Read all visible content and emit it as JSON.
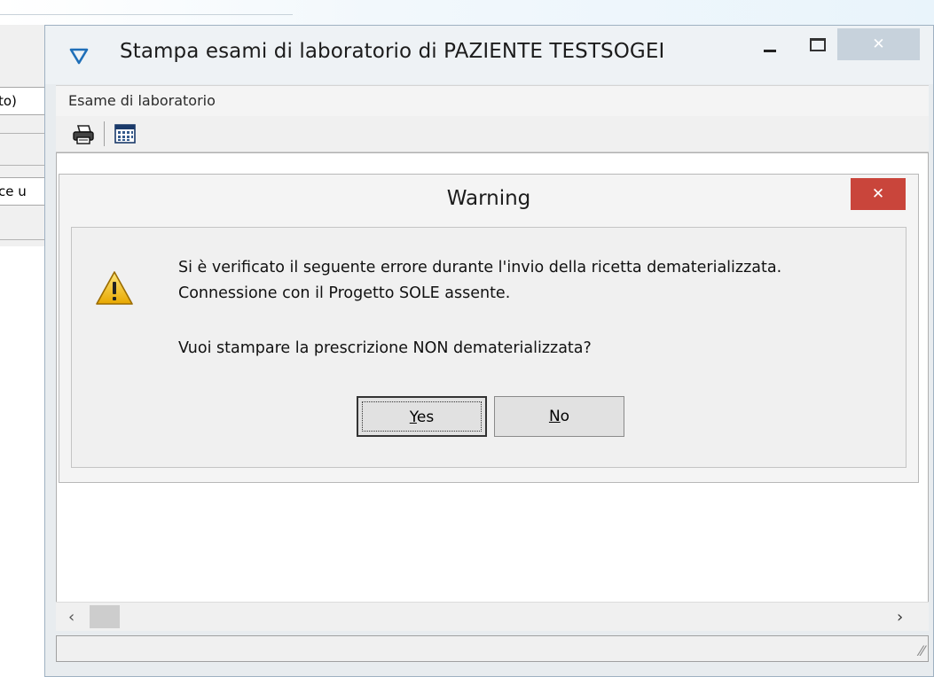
{
  "background_window": {
    "field1_text": "to)",
    "field2_text": "ce u"
  },
  "window": {
    "title": "Stampa esami di laboratorio di PAZIENTE TESTSOGEI",
    "app_icon": "triangle-down-icon",
    "close_symbol": "✕",
    "menu": [
      "Esame di laboratorio"
    ],
    "toolbar": [
      {
        "name": "print-icon"
      },
      {
        "name": "calendar-icon"
      }
    ],
    "scroll_left": "‹",
    "scroll_right": "›"
  },
  "dialog": {
    "title": "Warning",
    "close_symbol": "✕",
    "icon": "warning-icon",
    "message_line1": "Si è verificato il seguente errore durante l'invio della ricetta dematerializzata.",
    "message_line2": "Connessione con il Progetto SOLE assente.",
    "question": "Vuoi stampare la prescrizione NON dematerializzata?",
    "buttons": {
      "yes": {
        "mnemonic": "Y",
        "rest": "es"
      },
      "no": {
        "mnemonic": "N",
        "rest": "o"
      }
    }
  },
  "colors": {
    "dialog_close": "#c9453b",
    "main_close": "#c7d2dc",
    "warning_fill": "#f5c518"
  }
}
